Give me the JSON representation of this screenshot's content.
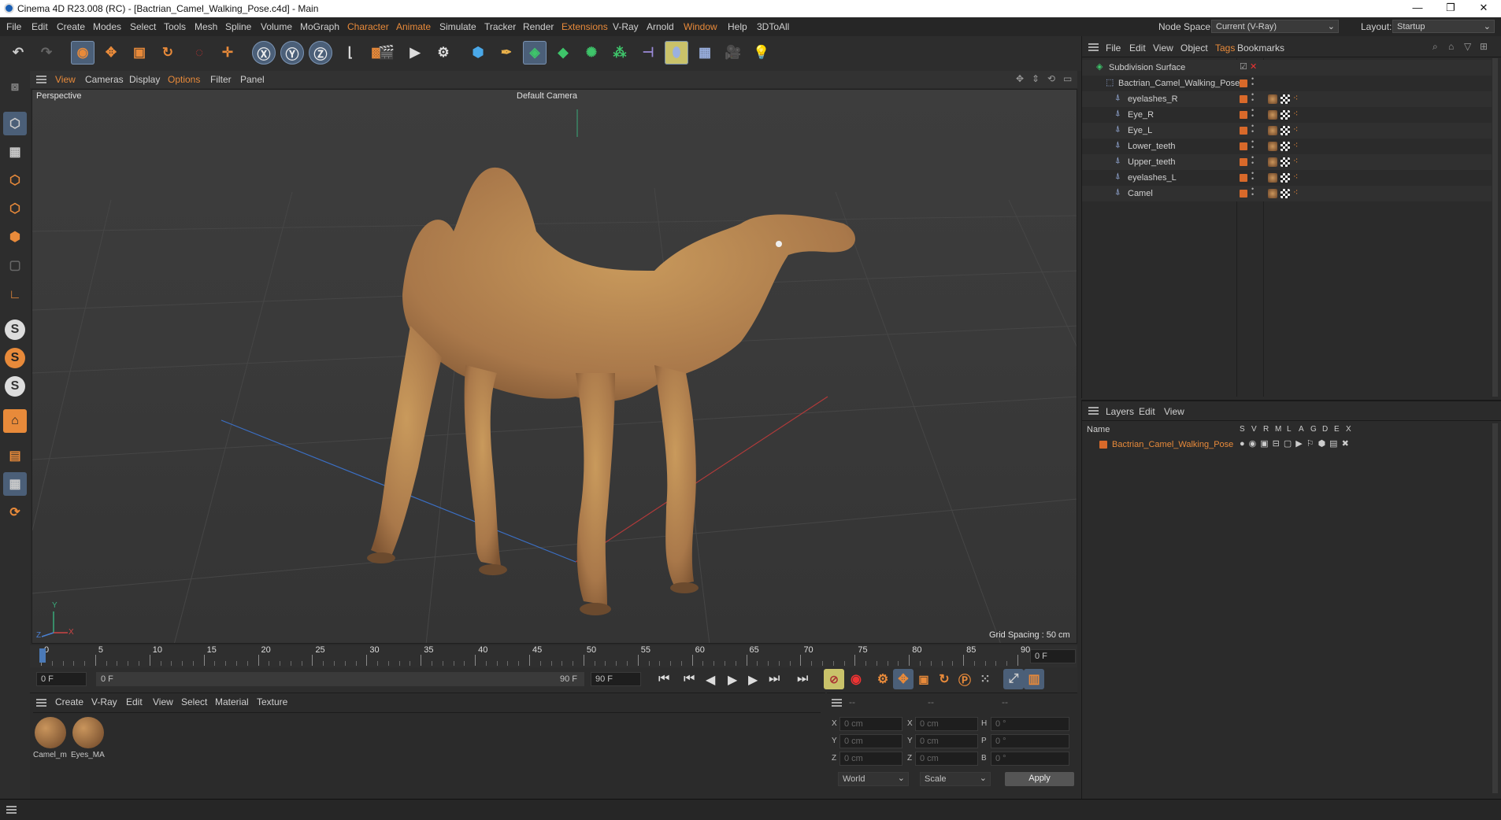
{
  "window": {
    "title": "Cinema 4D R23.008 (RC) - [Bactrian_Camel_Walking_Pose.c4d] - Main"
  },
  "menu": [
    "File",
    "Edit",
    "Create",
    "Modes",
    "Select",
    "Tools",
    "Mesh",
    "Spline",
    "Volume",
    "MoGraph",
    "Character",
    "Animate",
    "Simulate",
    "Tracker",
    "Render",
    "Extensions",
    "V-Ray",
    "Arnold",
    "Window",
    "Help",
    "3DToAll"
  ],
  "node_space": {
    "label": "Node Space:",
    "value": "Current (V-Ray)"
  },
  "layout": {
    "label": "Layout:",
    "value": "Startup"
  },
  "viewport_menu": [
    "View",
    "Cameras",
    "Display",
    "Options",
    "Filter",
    "Panel"
  ],
  "viewport": {
    "name": "Perspective",
    "camera": "Default Camera",
    "grid_spacing": "Grid Spacing : 50 cm"
  },
  "axis_labels": {
    "x": "X",
    "y": "Y",
    "z": "Z"
  },
  "timeline": {
    "ticks": [
      "0",
      "5",
      "10",
      "15",
      "20",
      "25",
      "30",
      "35",
      "40",
      "45",
      "50",
      "55",
      "60",
      "65",
      "70",
      "75",
      "80",
      "85",
      "90"
    ],
    "current_frame": "0 F"
  },
  "transport": {
    "start": "0 F",
    "range_start": "0 F",
    "range_end": "90 F",
    "end": "90 F"
  },
  "material_menu": [
    "Create",
    "V-Ray",
    "Edit",
    "View",
    "Select",
    "Material",
    "Texture"
  ],
  "materials": [
    {
      "name": "Camel_m"
    },
    {
      "name": "Eyes_MA"
    }
  ],
  "coords": {
    "headers": [
      "--",
      "--",
      "--"
    ],
    "rows": [
      {
        "a": "X",
        "av": "0 cm",
        "b": "X",
        "bv": "0 cm",
        "c": "H",
        "cv": "0 °"
      },
      {
        "a": "Y",
        "av": "0 cm",
        "b": "Y",
        "bv": "0 cm",
        "c": "P",
        "cv": "0 °"
      },
      {
        "a": "Z",
        "av": "0 cm",
        "b": "Z",
        "bv": "0 cm",
        "c": "B",
        "cv": "0 °"
      }
    ],
    "world": "World",
    "scale": "Scale",
    "apply": "Apply"
  },
  "object_menu": [
    "File",
    "Edit",
    "View",
    "Object",
    "Tags",
    "Bookmarks"
  ],
  "objects": [
    {
      "name": "Subdivision Surface",
      "level": 0
    },
    {
      "name": "Bactrian_Camel_Walking_Pose",
      "level": 1
    },
    {
      "name": "eyelashes_R",
      "level": 2
    },
    {
      "name": "Eye_R",
      "level": 2
    },
    {
      "name": "Eye_L",
      "level": 2
    },
    {
      "name": "Lower_teeth",
      "level": 2
    },
    {
      "name": "Upper_teeth",
      "level": 2
    },
    {
      "name": "eyelashes_L",
      "level": 2
    },
    {
      "name": "Camel",
      "level": 2
    }
  ],
  "layers_menu": [
    "Layers",
    "Edit",
    "View"
  ],
  "layers_header": {
    "name": "Name",
    "cols": [
      "S",
      "V",
      "R",
      "M",
      "L",
      "A",
      "G",
      "D",
      "E",
      "X"
    ]
  },
  "layers": [
    {
      "name": "Bactrian_Camel_Walking_Pose",
      "color": "#d8692a"
    }
  ],
  "colors": {
    "accent": "#e88a3a",
    "layer_text": "#e88a3a",
    "selected_tool": "#4b5f78"
  }
}
